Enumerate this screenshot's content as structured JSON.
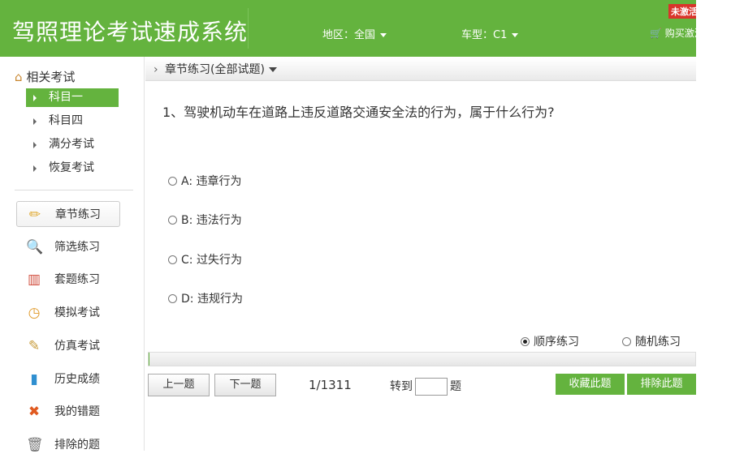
{
  "header": {
    "title": "驾照理论考试速成系统",
    "region": "地区：全国",
    "car_type": "车型：C1",
    "badge": "未激活",
    "buy": "购买激活"
  },
  "sidebar": {
    "related_title": "相关考试",
    "subjects": [
      "科目一",
      "科目四",
      "满分考试",
      "恢复考试"
    ],
    "nav": [
      {
        "label": "章节练习",
        "icon": "pencil-icon",
        "glyph": "✏"
      },
      {
        "label": "筛选练习",
        "icon": "search-icon",
        "glyph": "🔍"
      },
      {
        "label": "套题练习",
        "icon": "books-icon",
        "glyph": "▥"
      },
      {
        "label": "模拟考试",
        "icon": "clock-icon",
        "glyph": "◷"
      },
      {
        "label": "仿真考试",
        "icon": "notepad-icon",
        "glyph": "✎"
      },
      {
        "label": "历史成绩",
        "icon": "bar-chart-icon",
        "glyph": "▮"
      },
      {
        "label": "我的错题",
        "icon": "x-icon",
        "glyph": "✖"
      },
      {
        "label": "排除的题",
        "icon": "trash-icon",
        "glyph": "🗑"
      }
    ]
  },
  "breadcrumb": "章节练习(全部试题)",
  "question": {
    "text": "1、驾驶机动车在道路上违反道路交通安全法的行为，属于什么行为?",
    "options": [
      "A: 违章行为",
      "B: 违法行为",
      "C: 过失行为",
      "D: 违规行为"
    ]
  },
  "modes": {
    "sequential": "顺序练习",
    "random": "随机练习",
    "selected": "sequential"
  },
  "progress": 0.001,
  "controls": {
    "prev": "上一题",
    "next": "下一题",
    "count": "1/1311",
    "goto_prefix": "转到",
    "goto_value": "",
    "goto_suffix": "题",
    "favorite": "收藏此题",
    "exclude": "排除此题"
  },
  "colors": {
    "accent": "#64b33e",
    "badge": "#d9342b"
  }
}
